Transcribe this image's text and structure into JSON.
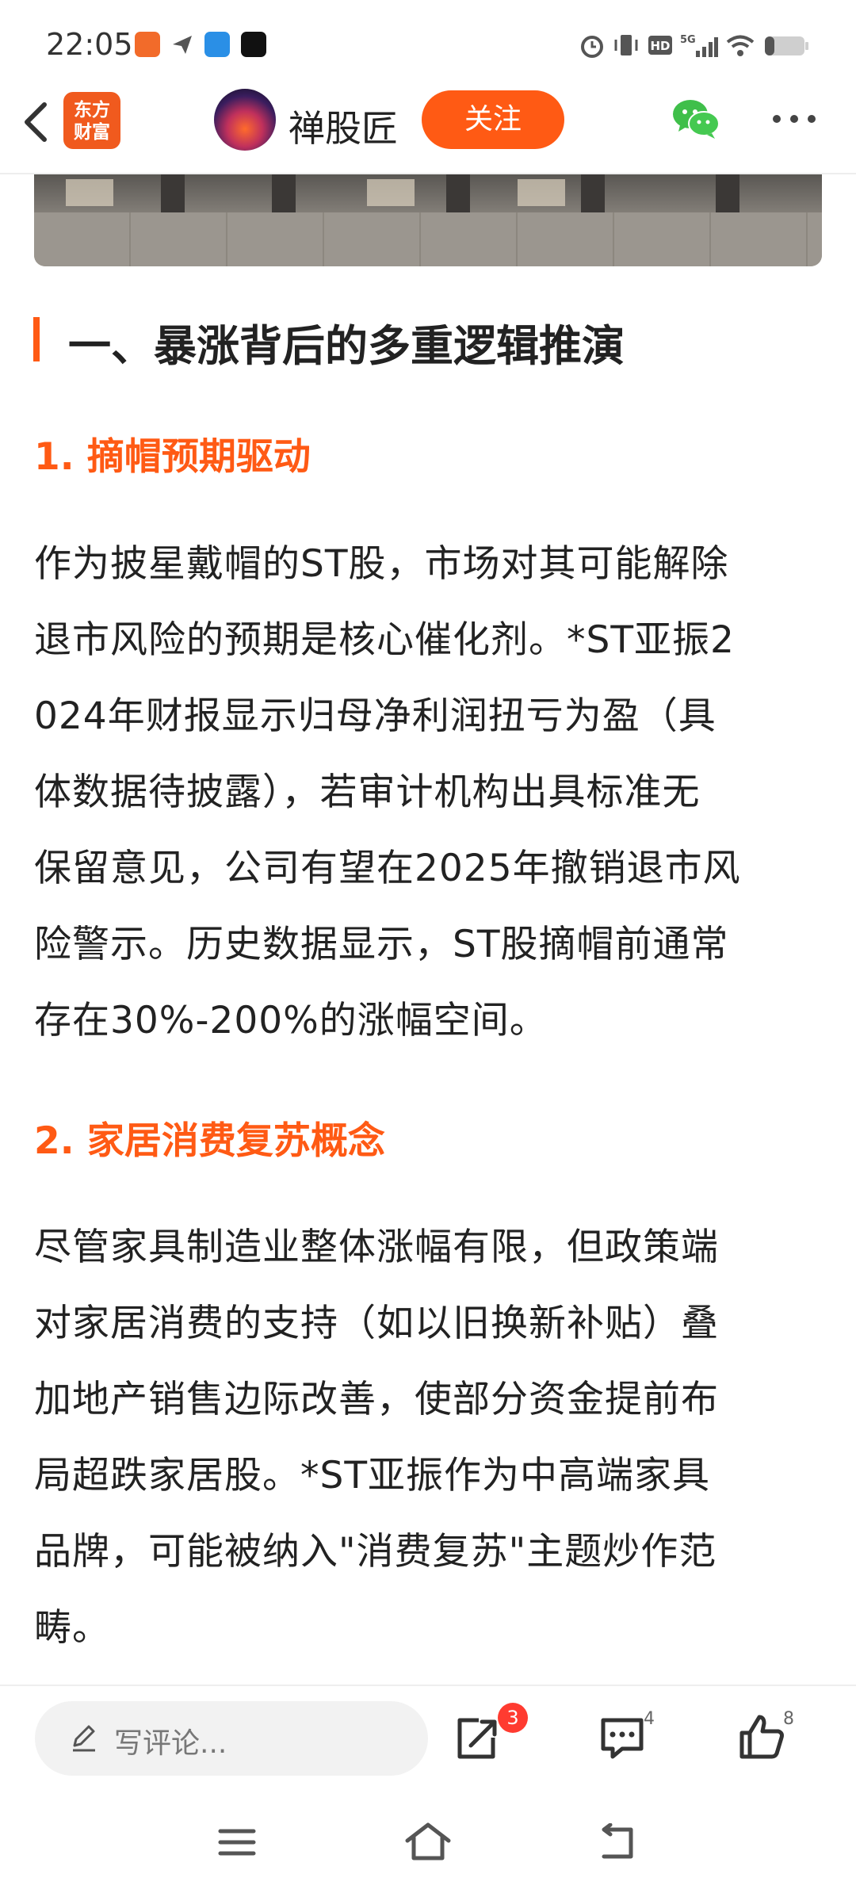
{
  "status_bar": {
    "time": "22:05",
    "apps": [
      "app-notification-icon",
      "send-icon",
      "e-app-icon",
      "tiktok-icon"
    ],
    "right_icons": [
      "alarm-icon",
      "vibrate-icon",
      "hd-icon",
      "5g-signal-icon",
      "wifi-icon",
      "battery-icon"
    ]
  },
  "nav": {
    "brand_logo_line1": "东方",
    "brand_logo_line2": "财富",
    "author_name": "禅股匠",
    "follow_label": "关注"
  },
  "article": {
    "section_title": "一、暴涨背后的多重逻辑推演",
    "subsections": [
      {
        "heading": "1. 摘帽预期驱动",
        "lines": [
          "作为披星戴帽的ST股，市场对其可能解除",
          "退市风险的预期是核心催化剂。*ST亚振2",
          "024年财报显示归母净利润扭亏为盈（具",
          "体数据待披露），若审计机构出具标准无",
          "保留意见，公司有望在2025年撤销退市风",
          "险警示。历史数据显示，ST股摘帽前通常",
          "存在30%-200%的涨幅空间。"
        ]
      },
      {
        "heading": "2. 家居消费复苏概念",
        "lines": [
          "尽管家具制造业整体涨幅有限，但政策端",
          "对家居消费的支持（如以旧换新补贴）叠",
          "加地产销售边际改善，使部分资金提前布",
          "局超跌家居股。*ST亚振作为中高端家具",
          "品牌，可能被纳入\"消费复苏\"主题炒作范",
          "畴。"
        ]
      }
    ]
  },
  "bottom_bar": {
    "comment_placeholder": "写评论...",
    "share_badge": "3",
    "comments_count": "4",
    "likes_count": "8"
  },
  "colors": {
    "accent": "#ff5a14",
    "badge": "#ff3b30"
  }
}
